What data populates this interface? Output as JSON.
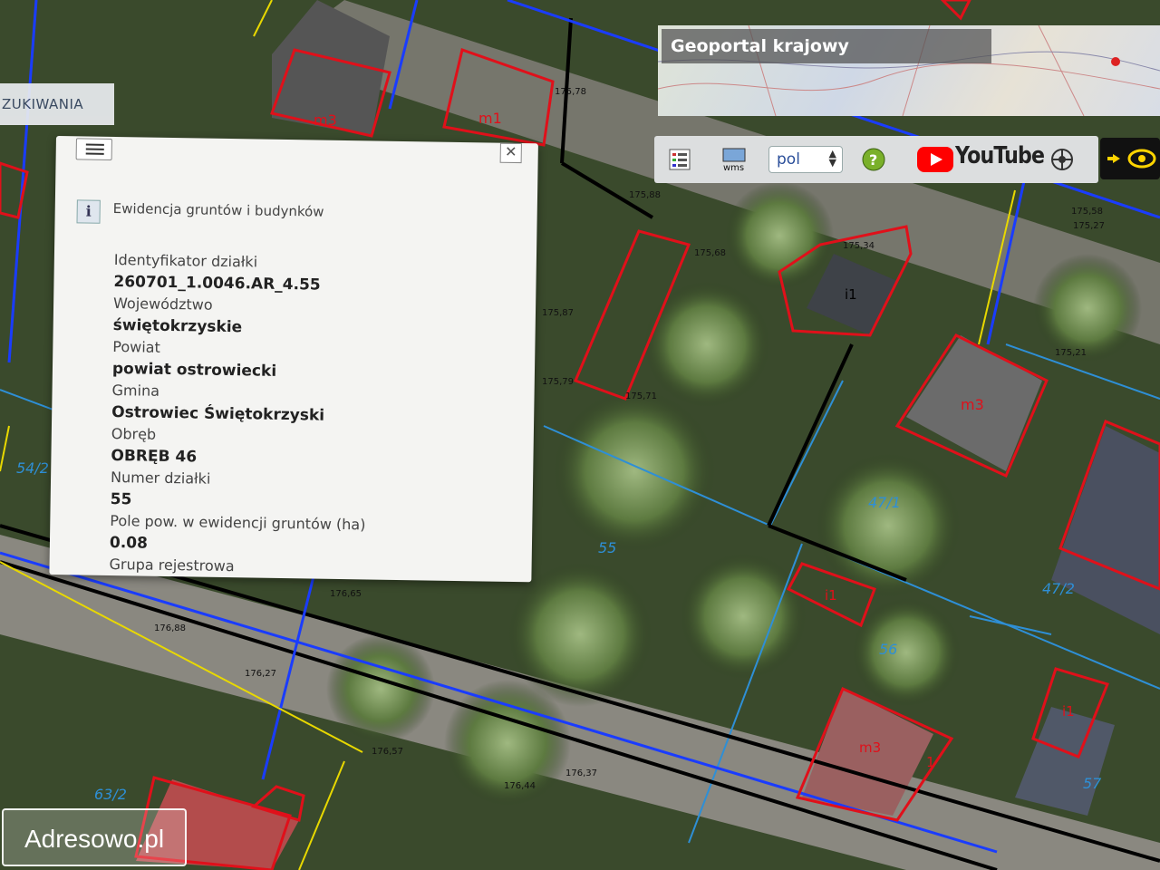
{
  "search_tab": {
    "label": "ZUKIWANIA"
  },
  "overview": {
    "title": "Geoportal krajowy"
  },
  "toolbar": {
    "language": "pol",
    "youtube_label": "YouTube",
    "icons": [
      "legend-icon",
      "wms-icon",
      "help-icon",
      "youtube-icon",
      "settings-icon",
      "eye-icon"
    ]
  },
  "popup": {
    "title": "Ewidencja gruntów i budynków",
    "fields": [
      {
        "label": "Identyfikator działki",
        "value": "260701_1.0046.AR_4.55"
      },
      {
        "label": "Województwo",
        "value": "świętokrzyskie"
      },
      {
        "label": "Powiat",
        "value": "powiat ostrowiecki"
      },
      {
        "label": "Gmina",
        "value": "Ostrowiec Świętokrzyski"
      },
      {
        "label": "Obręb",
        "value": "OBRĘB 46"
      },
      {
        "label": "Numer działki",
        "value": "55"
      },
      {
        "label": "Pole pow. w ewidencji gruntów (ha)",
        "value": "0.08"
      },
      {
        "label": "Grupa rejestrowa",
        "value": ""
      }
    ]
  },
  "map_labels": {
    "parcels": [
      "55",
      "56",
      "57",
      "47/1",
      "47/2",
      "54/2",
      "63/2"
    ],
    "buildings": [
      "m3",
      "m1",
      "m3",
      "i1",
      "i1",
      "i1",
      "m3",
      "1"
    ],
    "heights": [
      "175,88",
      "175,87",
      "175,79",
      "175,71",
      "175,78",
      "175,68",
      "175,58",
      "175,27",
      "175,21",
      "175,34",
      "176,27",
      "176,37",
      "176,44",
      "176,65",
      "176,57",
      "176,88"
    ],
    "colors": {
      "building": "#e0101a",
      "utility_blue": "#1a3cff",
      "utility_yellow": "#e8d800",
      "parcel_line": "#2e8fd6",
      "boundary": "#000000"
    }
  },
  "watermark": "Adresowo.pl"
}
